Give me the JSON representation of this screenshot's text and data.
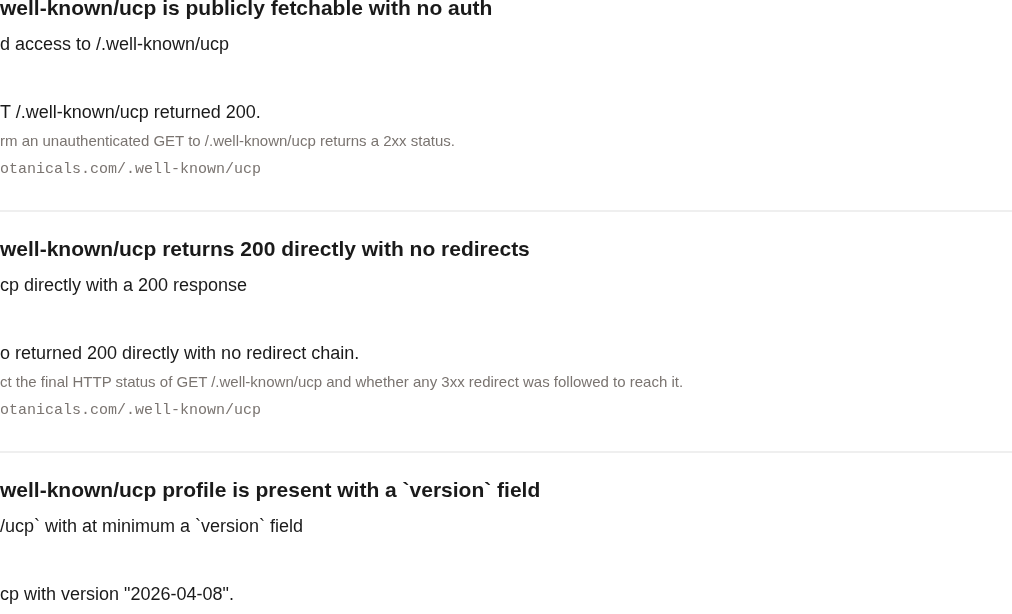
{
  "checks": [
    {
      "title": "well-known/ucp is publicly fetchable with no auth",
      "description": "d access to /.well-known/ucp",
      "result": "T /.well-known/ucp returned 200.",
      "hint": "rm an unauthenticated GET to /.well-known/ucp returns a 2xx status.",
      "url": "otanicals.com/.well-known/ucp"
    },
    {
      "title": "well-known/ucp returns 200 directly with no redirects",
      "description": "cp directly with a 200 response",
      "result": "o returned 200 directly with no redirect chain.",
      "hint": "ct the final HTTP status of GET /.well-known/ucp and whether any 3xx redirect was followed to reach it.",
      "url": "otanicals.com/.well-known/ucp"
    },
    {
      "title": "well-known/ucp profile is present with a `version` field",
      "description": "/ucp` with at minimum a `version` field",
      "result": "cp with version \"2026-04-08\"."
    }
  ]
}
